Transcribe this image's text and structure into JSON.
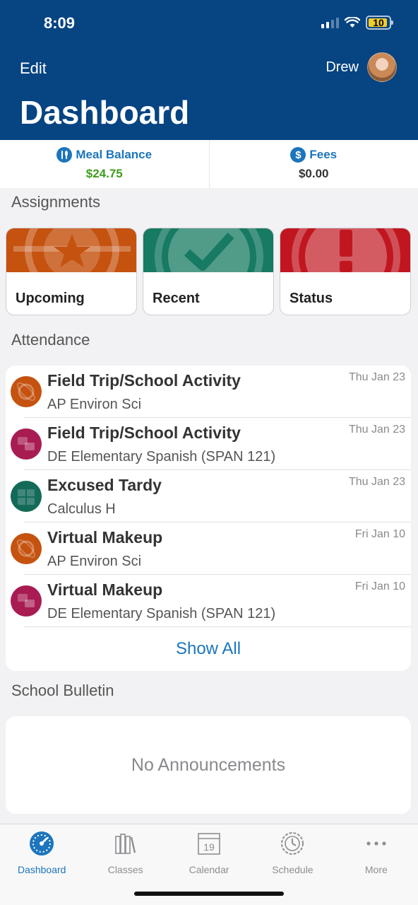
{
  "status_bar": {
    "time": "8:09",
    "battery": "10"
  },
  "header": {
    "edit_label": "Edit",
    "user_name": "Drew",
    "title": "Dashboard"
  },
  "balances": {
    "meal": {
      "label": "Meal Balance",
      "value": "$24.75",
      "icon": "fork-knife-icon"
    },
    "fees": {
      "label": "Fees",
      "value": "$0.00",
      "icon": "dollar-icon"
    }
  },
  "assignments": {
    "section_title": "Assignments",
    "cards": [
      {
        "label": "Upcoming",
        "icon": "star-icon",
        "color": "#c5520f"
      },
      {
        "label": "Recent",
        "icon": "check-icon",
        "color": "#177a62"
      },
      {
        "label": "Status",
        "icon": "exclamation-icon",
        "color": "#c11620"
      }
    ]
  },
  "attendance": {
    "section_title": "Attendance",
    "items": [
      {
        "title": "Field Trip/School Activity",
        "course": "AP Environ Sci",
        "date": "Thu Jan 23",
        "color": "#c5520f"
      },
      {
        "title": "Field Trip/School Activity",
        "course": "DE Elementary Spanish (SPAN 121)",
        "date": "Thu Jan 23",
        "color": "#a81c53"
      },
      {
        "title": "Excused Tardy",
        "course": "Calculus H",
        "date": "Thu Jan 23",
        "color": "#136a58"
      },
      {
        "title": "Virtual Makeup",
        "course": "AP Environ Sci",
        "date": "Fri Jan 10",
        "color": "#c5520f"
      },
      {
        "title": "Virtual Makeup",
        "course": "DE Elementary Spanish (SPAN 121)",
        "date": "Fri Jan 10",
        "color": "#a81c53"
      }
    ],
    "show_all_label": "Show All"
  },
  "bulletin": {
    "section_title": "School Bulletin",
    "empty_text": "No Announcements"
  },
  "tabbar": {
    "tabs": [
      {
        "label": "Dashboard",
        "icon": "gauge-icon"
      },
      {
        "label": "Classes",
        "icon": "books-icon"
      },
      {
        "label": "Calendar",
        "icon": "calendar-icon",
        "day": "19"
      },
      {
        "label": "Schedule",
        "icon": "clock-icon"
      },
      {
        "label": "More",
        "icon": "more-dots-icon"
      }
    ]
  },
  "colors": {
    "header": "#064482",
    "accent": "#1c75bd",
    "meal_value": "#3f9d1d"
  }
}
